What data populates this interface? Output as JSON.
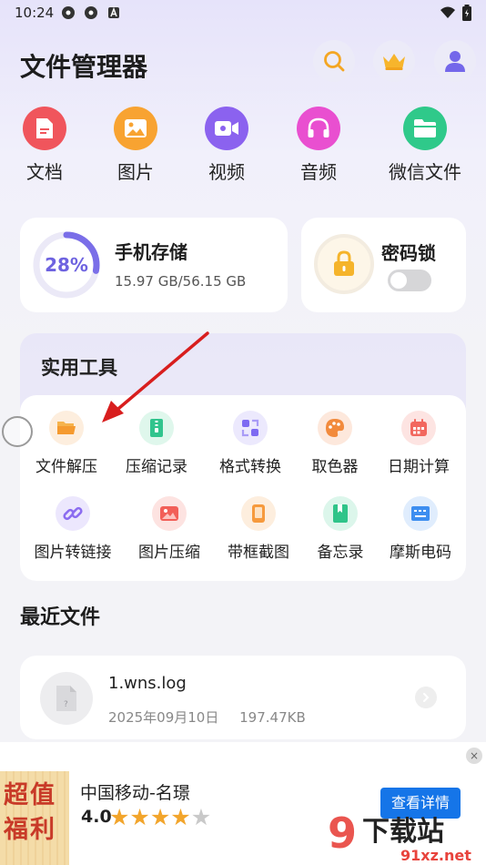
{
  "status_bar": {
    "time": "10:24"
  },
  "header": {
    "title": "文件管理器"
  },
  "categories": [
    {
      "label": "文档",
      "color": "#f0555c",
      "icon": "document-icon"
    },
    {
      "label": "图片",
      "color": "#f8a331",
      "icon": "image-icon"
    },
    {
      "label": "视频",
      "color": "#8b62ef",
      "icon": "video-icon"
    },
    {
      "label": "音频",
      "color": "#e94fd0",
      "icon": "headphones-icon"
    },
    {
      "label": "微信文件",
      "color": "#2fc98a",
      "icon": "folder-icon"
    }
  ],
  "storage": {
    "title": "手机存储",
    "percent": "28%",
    "percent_value": 0.28,
    "size": "15.97 GB/56.15 GB"
  },
  "lock": {
    "title": "密码锁",
    "enabled": false
  },
  "tools": {
    "title": "实用工具",
    "items": [
      {
        "label": "文件解压",
        "icon": "folder-open-icon",
        "color": "#f6a13a"
      },
      {
        "label": "压缩记录",
        "icon": "zip-icon",
        "color": "#31c48d"
      },
      {
        "label": "格式转换",
        "icon": "convert-icon",
        "color": "#7d6af2"
      },
      {
        "label": "取色器",
        "icon": "palette-icon",
        "color": "#f28a3c"
      },
      {
        "label": "日期计算",
        "icon": "calendar-icon",
        "color": "#f2675e"
      },
      {
        "label": "图片转链接",
        "icon": "link-icon",
        "color": "#8b6cf0"
      },
      {
        "label": "图片压缩",
        "icon": "image-compress-icon",
        "color": "#f25f58"
      },
      {
        "label": "带框截图",
        "icon": "phone-frame-icon",
        "color": "#f69a3d"
      },
      {
        "label": "备忘录",
        "icon": "bookmark-icon",
        "color": "#2fc489"
      },
      {
        "label": "摩斯电码",
        "icon": "keyboard-icon",
        "color": "#3d8ef0"
      }
    ]
  },
  "recent": {
    "title": "最近文件",
    "files": [
      {
        "name": "1.wns.log",
        "date": "2025年09月10日",
        "size": "197.47KB"
      }
    ]
  },
  "ad": {
    "image_text": "超值福利",
    "title": "中国移动-名璟",
    "rating": "4.0",
    "rating_value": 4,
    "button": "查看详情",
    "close": "×"
  },
  "watermark": {
    "text": "9下载站",
    "url": "91xz.net"
  },
  "colors": {
    "accent": "#6e63e0",
    "arrow": "#d81e1e",
    "ad_button": "#1575e8"
  }
}
